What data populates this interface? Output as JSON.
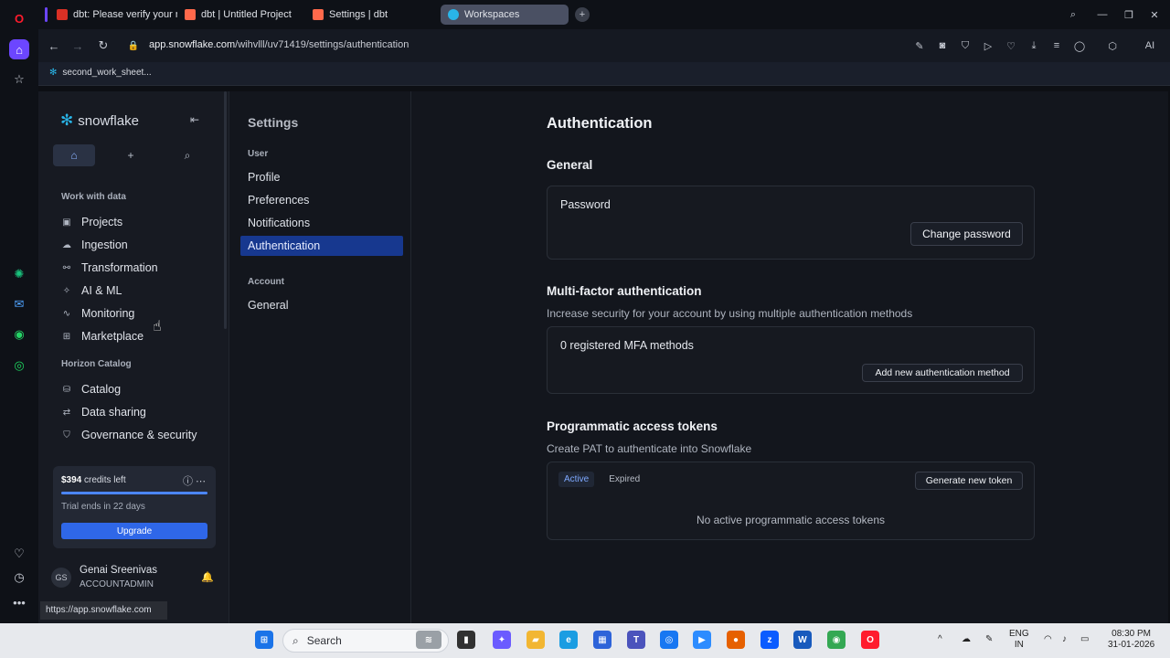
{
  "browser": {
    "tabs": [
      {
        "label": "dbt: Please verify your nev",
        "favicon_color": "#d93025"
      },
      {
        "label": "dbt | Untitled Project",
        "favicon_color": "#ff694b"
      },
      {
        "label": "Settings | dbt",
        "favicon_color": "#ff694b"
      },
      {
        "label": "Workspaces",
        "favicon_color": "#29b5e8"
      }
    ],
    "url_host": "app.snowflake.com",
    "url_path": "/wihvlll/uv71419/settings/authentication",
    "bookmark": "second_work_sheet...",
    "status_url": "https://app.snowflake.com",
    "ai_label": "AI"
  },
  "sidebar": {
    "brand": "snowflake",
    "sections": [
      {
        "title": "Work with data",
        "items": [
          "Projects",
          "Ingestion",
          "Transformation",
          "AI & ML",
          "Monitoring",
          "Marketplace"
        ]
      },
      {
        "title": "Horizon Catalog",
        "items": [
          "Catalog",
          "Data sharing",
          "Governance & security"
        ]
      }
    ],
    "credits": {
      "amount": "$394",
      "label": " credits left",
      "trial": "Trial ends in 22 days",
      "upgrade": "Upgrade",
      "progress_fraction": 1.0
    },
    "user": {
      "initials": "GS",
      "name": "Genai Sreenivas",
      "role": "ACCOUNTADMIN"
    }
  },
  "settings_nav": {
    "title": "Settings",
    "user_section": "User",
    "user_items": [
      "Profile",
      "Preferences",
      "Notifications",
      "Authentication"
    ],
    "account_section": "Account",
    "account_items": [
      "General"
    ]
  },
  "main": {
    "title": "Authentication",
    "general": {
      "heading": "General",
      "password_label": "Password",
      "change_password": "Change password"
    },
    "mfa": {
      "heading": "Multi-factor authentication",
      "description": "Increase security for your account by using multiple authentication methods",
      "count_label": "0 registered MFA methods",
      "add_button": "Add new authentication method"
    },
    "pat": {
      "heading": "Programmatic access tokens",
      "description": "Create PAT to authenticate into Snowflake",
      "tabs": [
        "Active",
        "Expired"
      ],
      "generate_button": "Generate new token",
      "empty_text": "No active programmatic access tokens"
    }
  },
  "taskbar": {
    "search": "Search",
    "lang1": "ENG",
    "lang2": "IN",
    "time": "08:30 PM",
    "date": "31-01-2026"
  }
}
